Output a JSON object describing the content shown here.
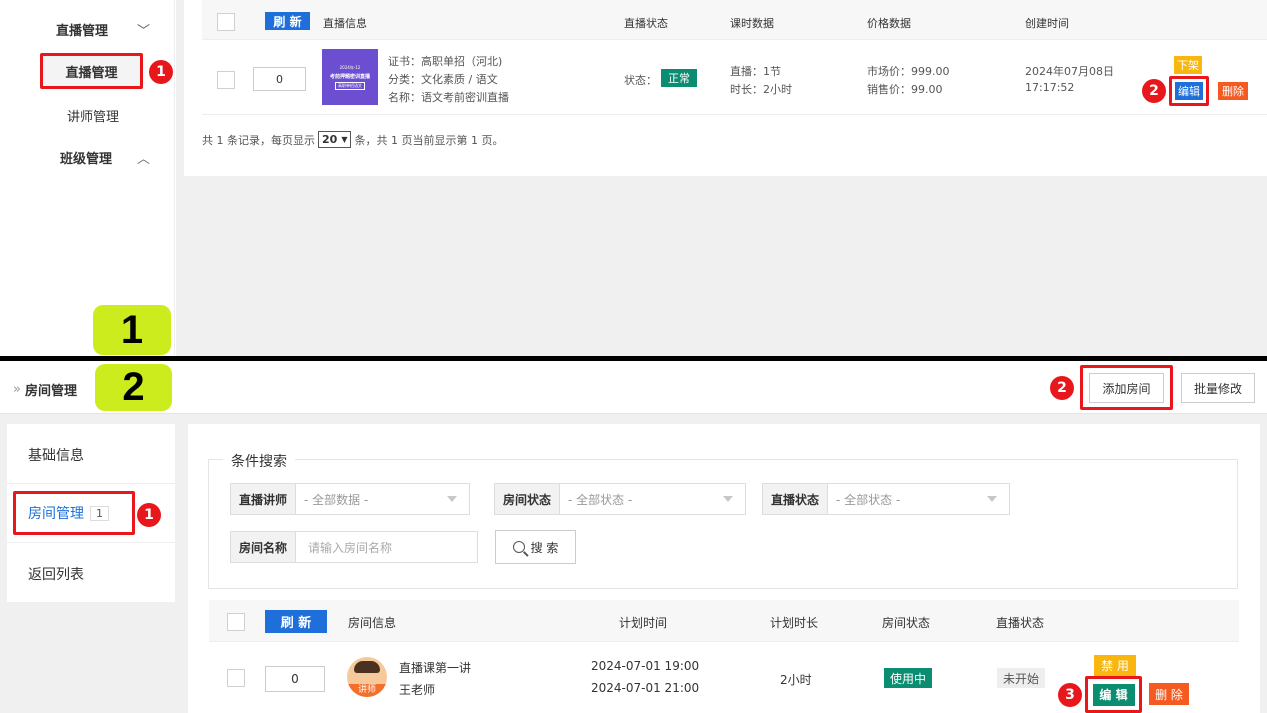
{
  "top": {
    "sidebar": {
      "live_mgmt": "直播管理",
      "live_mgmt_sub": "直播管理",
      "teacher_mgmt": "讲师管理",
      "class_mgmt": "班级管理",
      "chevron_down": "﹀",
      "chevron_up": "︿"
    },
    "table": {
      "refresh": "刷 新",
      "headers": [
        "直播信息",
        "直播状态",
        "课时数据",
        "价格数据",
        "创建时间"
      ],
      "row": {
        "order": "0",
        "thumb_top": "2024年-12",
        "thumb_mid": "考前押题密训直播",
        "thumb_bot": "高职单招语文",
        "cert": "证书：高职单招（河北)",
        "category": "分类：文化素质 / 语文",
        "name": "名称：语文考前密训直播",
        "status_label": "状态：",
        "status": "正常",
        "lessons": "直播：1节",
        "duration": "时长：2小时",
        "market_price": "市场价：999.00",
        "sale_price": "销售价：99.00",
        "created_date": "2024年07月08日",
        "created_time": "17:17:52",
        "off_shelf": "下架",
        "edit": "编辑",
        "delete": "删除"
      },
      "pager_a": "共 1 条记录，每页显示",
      "page_size": "20",
      "pager_b": "条，共 1 页当前显示第 1 页。"
    },
    "label": "1",
    "markers": [
      "1",
      "2"
    ]
  },
  "bottom": {
    "breadcrumb_prefix": "»",
    "breadcrumb": "房间管理",
    "label": "2",
    "add_room": "添加房间",
    "batch_edit": "批量修改",
    "sidebar": {
      "basic_info": "基础信息",
      "room_mgmt": "房间管理",
      "room_count": "1",
      "back_list": "返回列表"
    },
    "search": {
      "legend": "条件搜索",
      "teacher_label": "直播讲师",
      "teacher_value": "- 全部数据 -",
      "room_status_label": "房间状态",
      "room_status_value": "- 全部状态 -",
      "live_status_label": "直播状态",
      "live_status_value": "- 全部状态 -",
      "room_name_label": "房间名称",
      "room_name_placeholder": "请输入房间名称",
      "search_btn": "搜 索"
    },
    "table": {
      "refresh": "刷 新",
      "headers": [
        "房间信息",
        "计划时间",
        "计划时长",
        "房间状态",
        "直播状态"
      ],
      "row": {
        "order": "0",
        "avatar_tag": "讲师",
        "title": "直播课第一讲",
        "teacher": "王老师",
        "start": "2024-07-01 19:00",
        "end": "2024-07-01 21:00",
        "duration": "2小时",
        "room_status": "使用中",
        "live_status": "未开始",
        "disable": "禁 用",
        "edit": "编 辑",
        "delete": "删 除"
      }
    },
    "markers": [
      "1",
      "2",
      "3"
    ]
  }
}
